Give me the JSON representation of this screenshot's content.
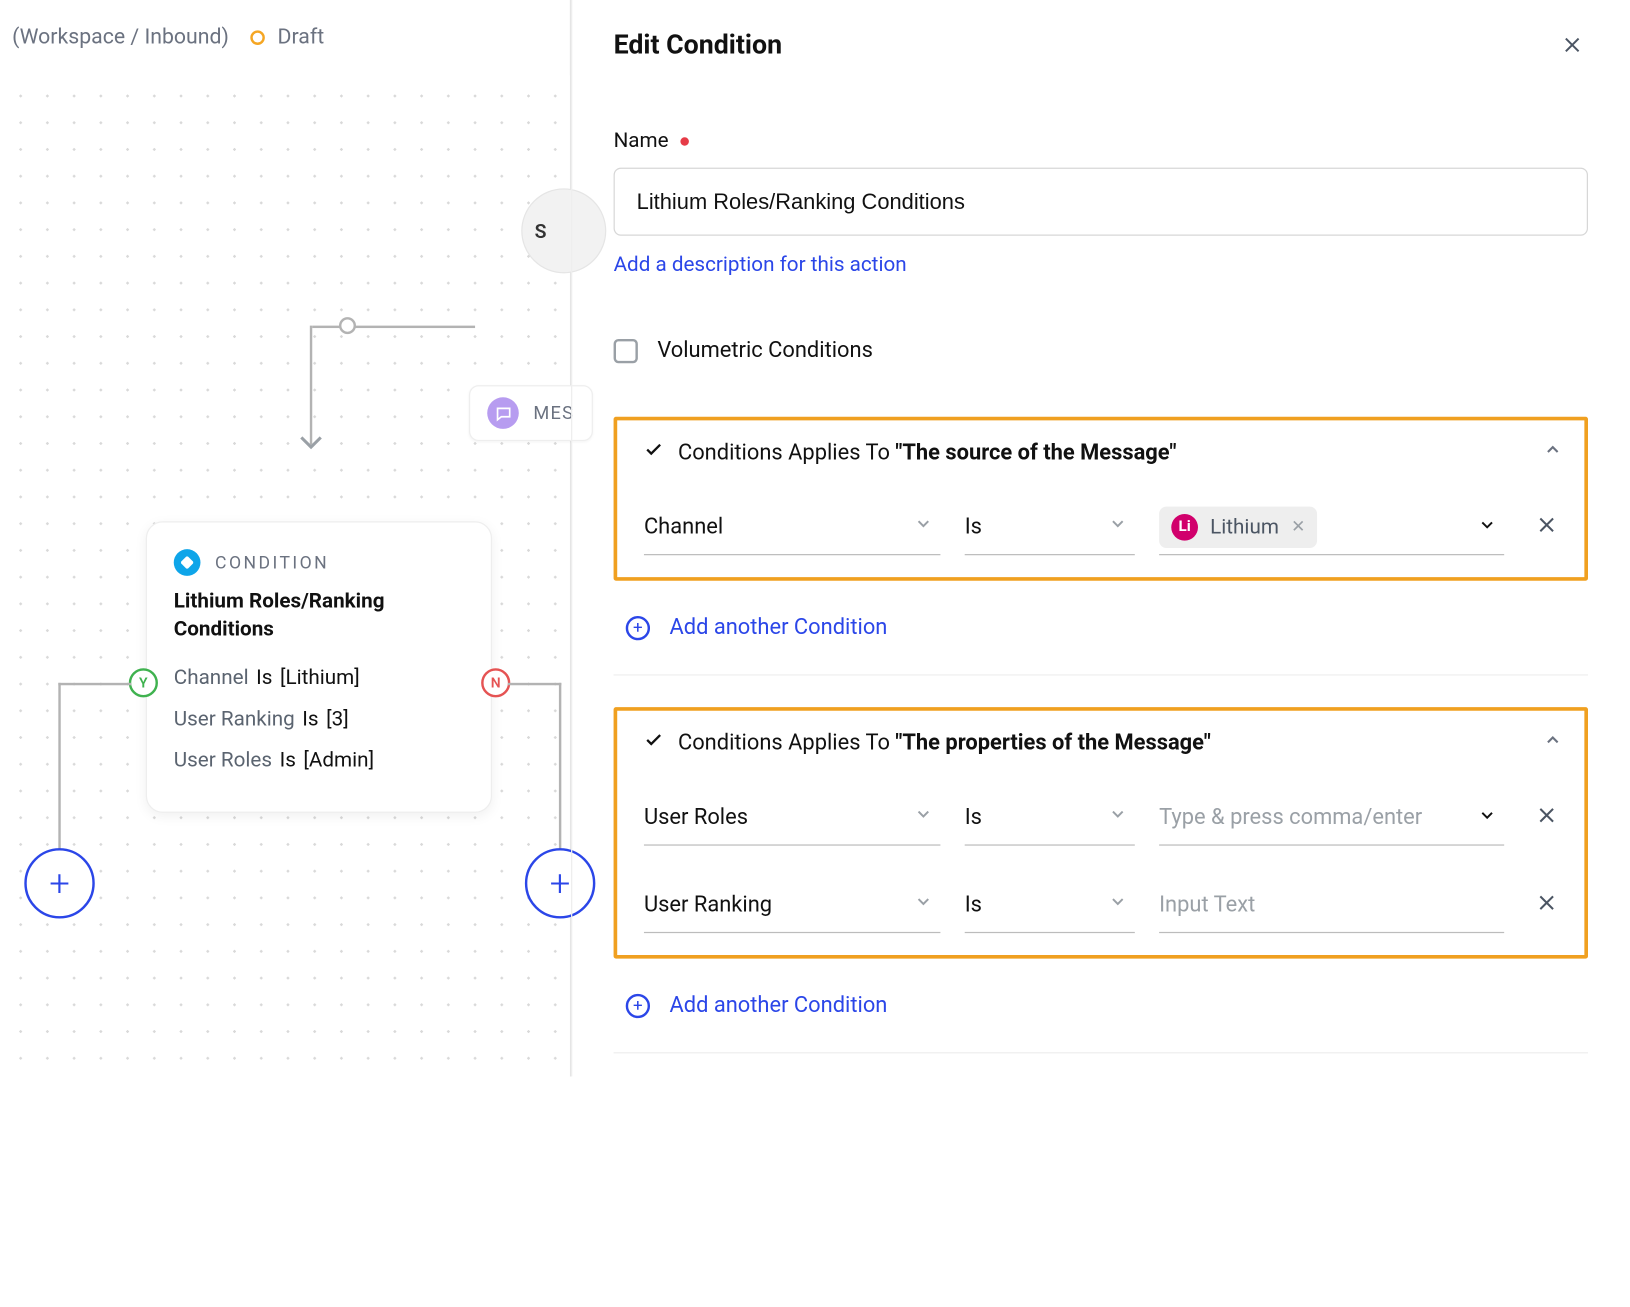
{
  "topbar": {
    "breadcrumb": "(Workspace / Inbound)",
    "status_label": "Draft"
  },
  "canvas": {
    "stage_node_text": "S",
    "message_pill_label": "MES",
    "condition_card": {
      "type_label": "CONDITION",
      "title": "Lithium Roles/Ranking Conditions",
      "rows": [
        {
          "key": "Channel",
          "op": "Is",
          "val": "[Lithium]"
        },
        {
          "key": "User Ranking",
          "op": "Is",
          "val": "[3]"
        },
        {
          "key": "User Roles",
          "op": "Is",
          "val": "[Admin]"
        }
      ]
    },
    "badges": {
      "yes": "Y",
      "no": "N"
    }
  },
  "panel": {
    "title": "Edit Condition",
    "name_label": "Name",
    "name_value": "Lithium Roles/Ranking Conditions",
    "add_description_link": "Add a description for this action",
    "volumetric_label": "Volumetric Conditions",
    "add_condition_label": "Add another Condition",
    "groups": [
      {
        "prefix": "Conditions Applies To ",
        "subject": "\"The source of the Message\"",
        "rows": [
          {
            "field": "Channel",
            "op": "Is",
            "chip": {
              "icon_text": "Li",
              "label": "Lithium"
            },
            "value_caret": true
          }
        ]
      },
      {
        "prefix": "Conditions Applies To ",
        "subject": "\"The properties of the Message\"",
        "rows": [
          {
            "field": "User Roles",
            "op": "Is",
            "placeholder": "Type & press comma/enter",
            "value_caret": true
          },
          {
            "field": "User Ranking",
            "op": "Is",
            "placeholder": "Input Text",
            "value_caret": false
          }
        ]
      }
    ]
  }
}
